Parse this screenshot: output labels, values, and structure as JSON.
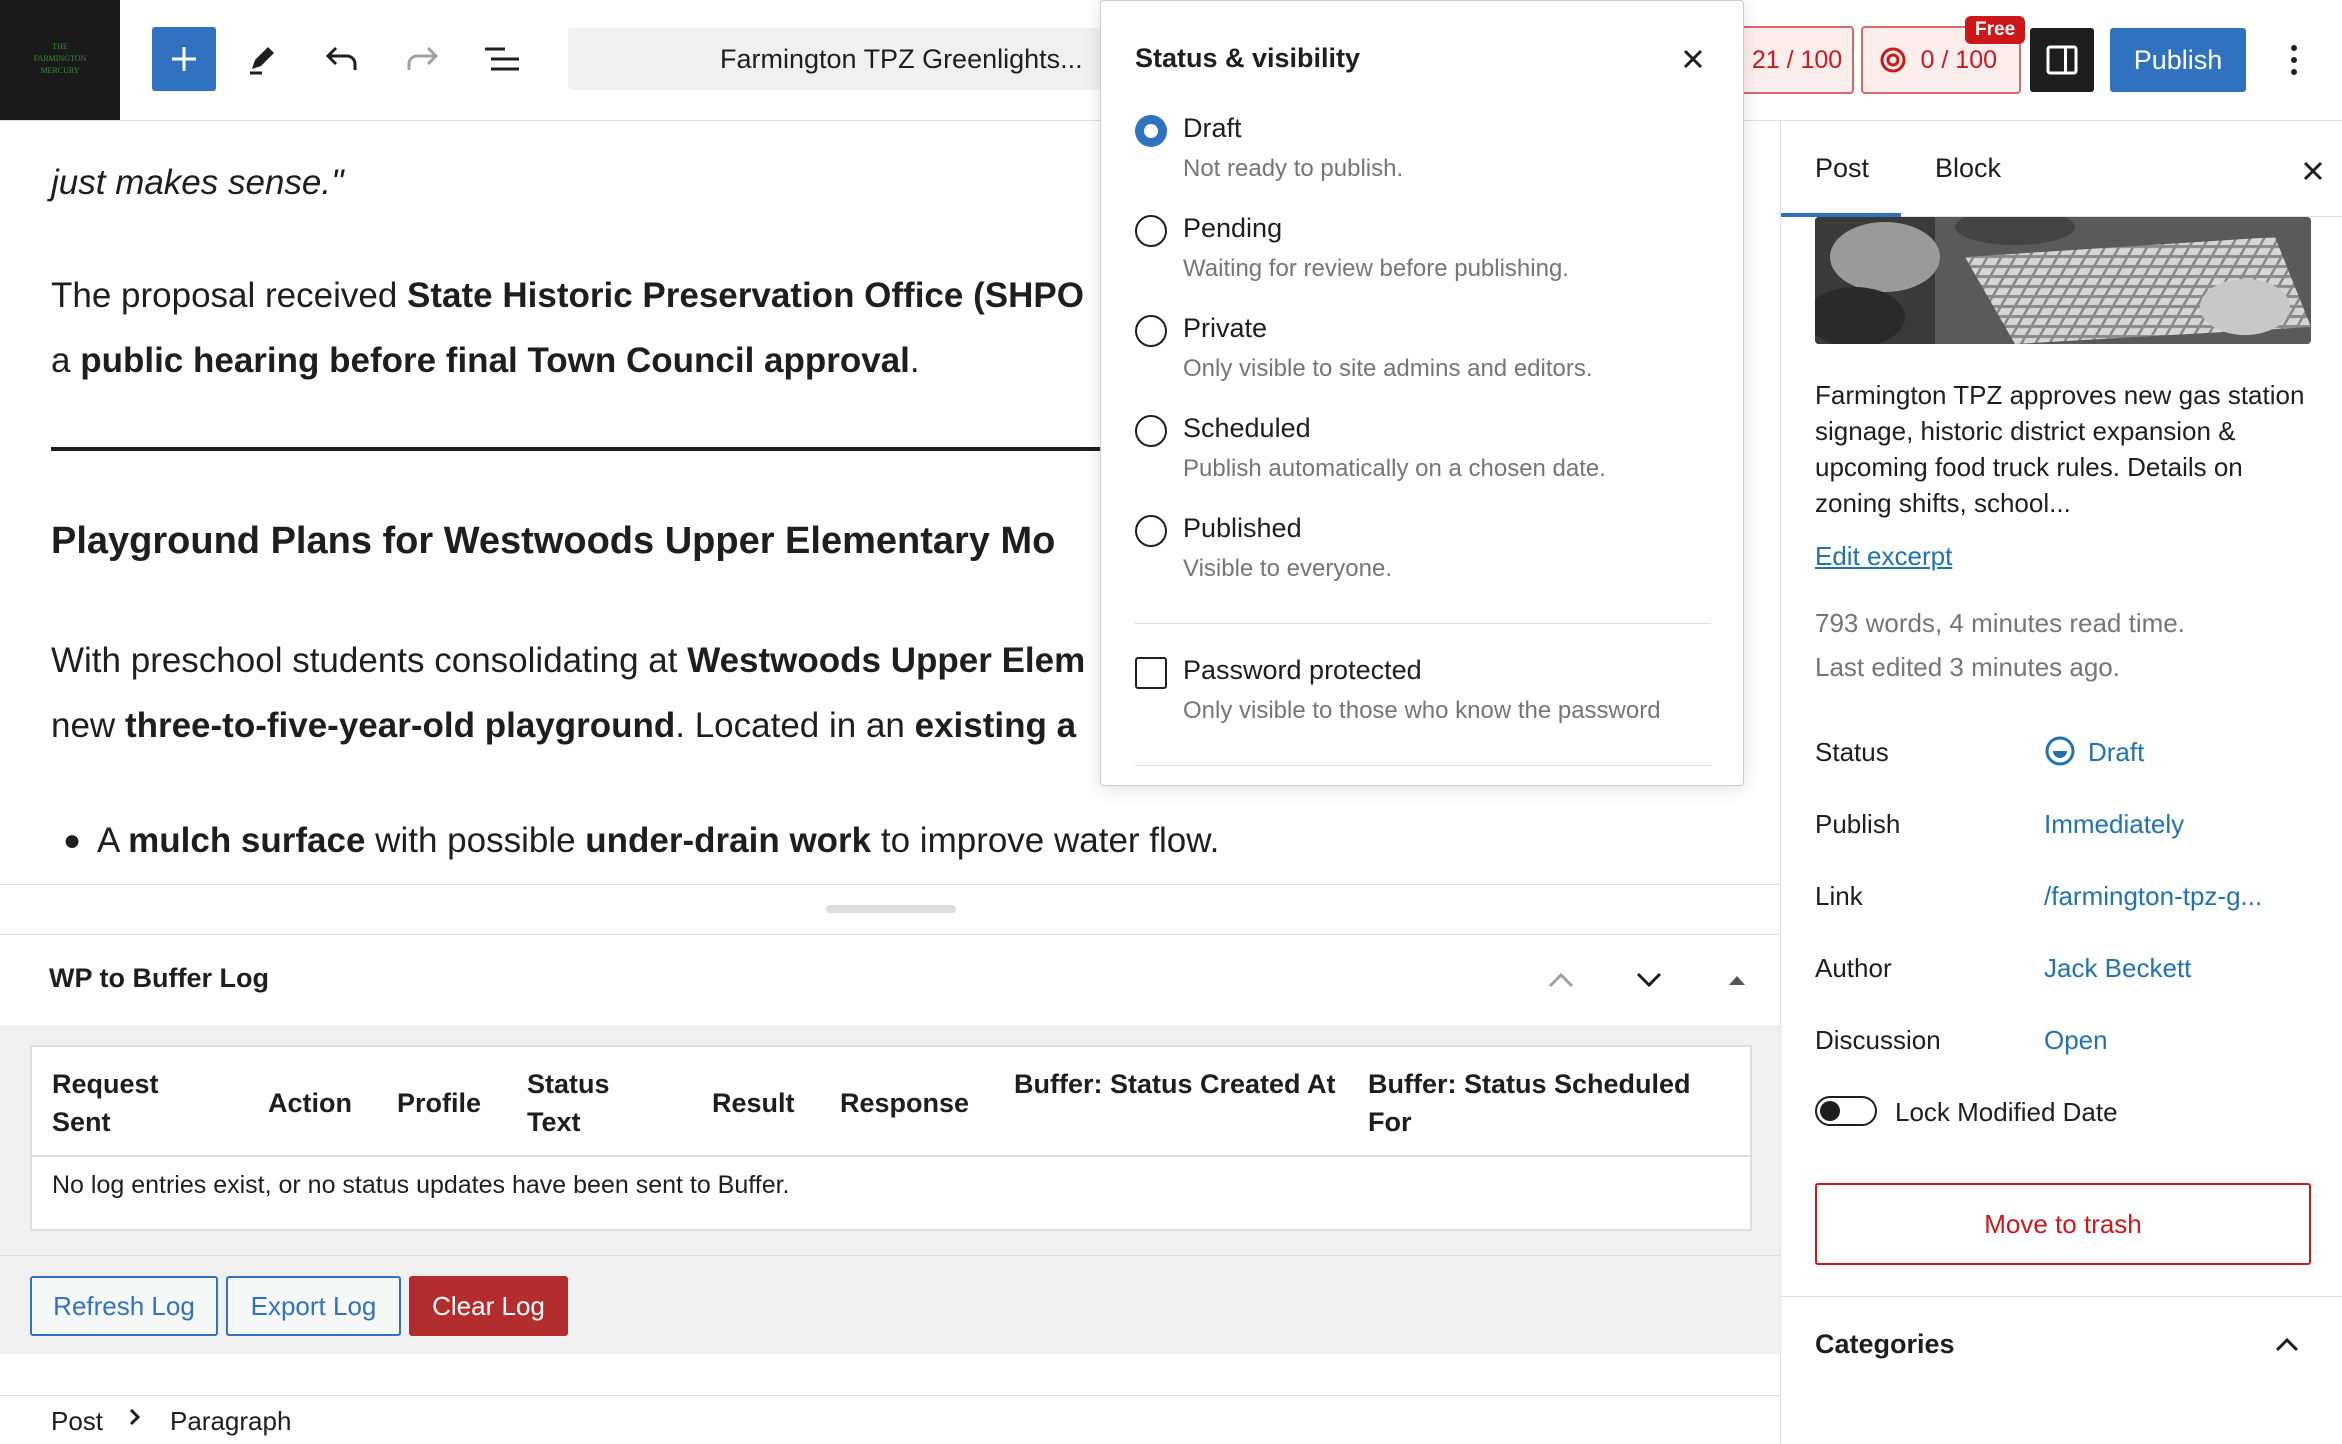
{
  "site": {
    "logo_text": "THE FARMINGTON MERCURY"
  },
  "toolbar": {
    "document_title": "Farmington TPZ Greenlights...",
    "score_readability": "21 / 100",
    "score_seo": "0 / 100",
    "free_badge": "Free",
    "publish_label": "Publish"
  },
  "editor": {
    "line1_italic": "just makes sense.\"",
    "p2_start": "The proposal received ",
    "p2_bold": "State Historic Preservation Office (SHPO",
    "p3_a": "a ",
    "p3_bold": "public hearing before final Town Council approval",
    "p3_end": ".",
    "heading": "Playground Plans for Westwoods Upper Elementary Mo",
    "p4_start": "With preschool students consolidating at ",
    "p4_bold": "Westwoods Upper Elem",
    "p5_a": "new ",
    "p5_bold1": "three-to-five-year-old playground",
    "p5_mid": ". Located in an ",
    "p5_bold2": "existing a",
    "li_a": "A ",
    "li_bold1": "mulch surface",
    "li_mid": " with possible ",
    "li_bold2": "under-drain work",
    "li_end": " to improve water flow."
  },
  "status_popover": {
    "title": "Status & visibility",
    "options": [
      {
        "label": "Draft",
        "desc": "Not ready to publish.",
        "checked": true
      },
      {
        "label": "Pending",
        "desc": "Waiting for review before publishing.",
        "checked": false
      },
      {
        "label": "Private",
        "desc": "Only visible to site admins and editors.",
        "checked": false
      },
      {
        "label": "Scheduled",
        "desc": "Publish automatically on a chosen date.",
        "checked": false
      },
      {
        "label": "Published",
        "desc": "Visible to everyone.",
        "checked": false
      }
    ],
    "password_label": "Password protected",
    "password_desc": "Only visible to those who know the password"
  },
  "metabox": {
    "title": "WP to Buffer Log",
    "columns": [
      "Request Sent",
      "Action",
      "Profile",
      "Status Text",
      "Result",
      "Response",
      "Buffer: Status Created At",
      "Buffer: Status Scheduled For"
    ],
    "empty_message": "No log entries exist, or no status updates have been sent to Buffer.",
    "refresh_label": "Refresh Log",
    "export_label": "Export Log",
    "clear_label": "Clear Log"
  },
  "breadcrumb": {
    "item1": "Post",
    "item2": "Paragraph"
  },
  "sidebar": {
    "tab_post": "Post",
    "tab_block": "Block",
    "excerpt": "Farmington TPZ approves new gas station signage, historic district expansion & upcoming food truck rules. Details on zoning shifts, school...",
    "edit_excerpt": "Edit excerpt",
    "word_count": "793 words, 4 minutes read time.",
    "last_edited": "Last edited 3 minutes ago.",
    "rows": {
      "status_label": "Status",
      "status_value": "Draft",
      "publish_label": "Publish",
      "publish_value": "Immediately",
      "link_label": "Link",
      "link_value": "/farmington-tpz-g...",
      "author_label": "Author",
      "author_value": "Jack Beckett",
      "discussion_label": "Discussion",
      "discussion_value": "Open"
    },
    "lock_label": "Lock Modified Date",
    "trash_label": "Move to trash",
    "categories_label": "Categories"
  },
  "colors": {
    "accent": "#3072c0",
    "danger": "#cc1818",
    "clear_button": "#b32d2e"
  }
}
